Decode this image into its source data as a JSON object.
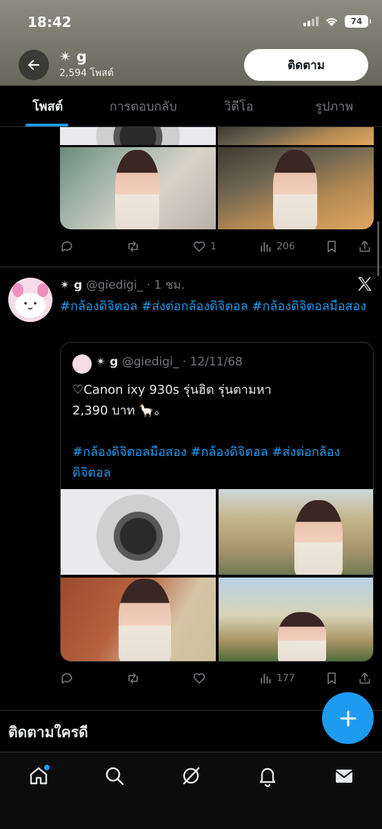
{
  "status_bar": {
    "time": "18:42",
    "battery": "74"
  },
  "header": {
    "name": "✴ g",
    "post_count": "2,594 โพสต์",
    "follow_label": "ติดตาม"
  },
  "tabs": [
    {
      "label": "โพสต์",
      "active": true
    },
    {
      "label": "การตอบกลับ",
      "active": false
    },
    {
      "label": "วิดีโอ",
      "active": false
    },
    {
      "label": "รูปภาพ",
      "active": false
    }
  ],
  "tweet1": {
    "likes": "1",
    "views": "206"
  },
  "tweet2": {
    "name": "✴ g",
    "handle": "@giedigi_",
    "time": "· 1 ชม.",
    "text": "#กล้องดิจิตอล #ส่งต่อกล้องดิจิตอล #กล้องดิจิตอลมือสอง",
    "views": "177",
    "quote": {
      "name": "✴ g",
      "handle": "@giedigi_",
      "date": "· 12/11/68",
      "text": "♡Canon ixy 930s รุ่นฮิต รุ่นตามหา\n 2,390 บาท 🦙。",
      "tags": "#กล้องดิจิตอลมือสอง #กล้องดิจิตอล #ส่งต่อกล้องดิจิตอล"
    }
  },
  "who_to_follow": "ติดตามใครดี",
  "colors": {
    "accent": "#1d9bf0",
    "background": "#000000",
    "muted": "#71767b",
    "text": "#e7e9ea"
  },
  "icons": {
    "reply": "reply-icon",
    "retweet": "retweet-icon",
    "like": "heart-icon",
    "views": "views-icon",
    "bookmark": "bookmark-icon",
    "share": "share-icon",
    "nav": [
      "home-icon",
      "search-icon",
      "grok-icon",
      "notifications-icon",
      "messages-icon"
    ]
  }
}
